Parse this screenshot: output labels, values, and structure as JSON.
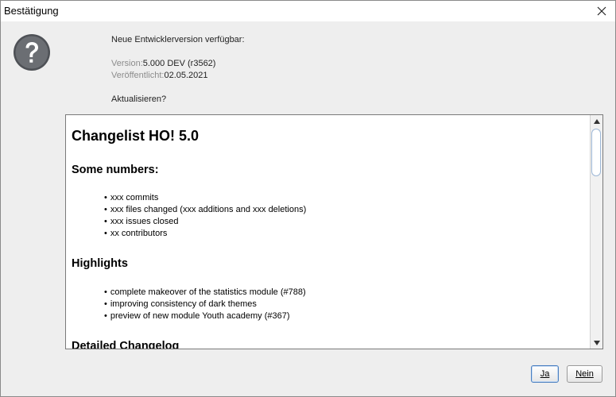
{
  "window": {
    "title": "Bestätigung"
  },
  "message": {
    "intro": "Neue Entwicklerversion verfügbar:",
    "version_label": "Version:",
    "version_value": "5.000 DEV (r3562)",
    "published_label": "Veröffentlicht:",
    "published_value": "02.05.2021",
    "question": "Aktualisieren?"
  },
  "changelog": {
    "title": "Changelist HO! 5.0",
    "sections": [
      {
        "heading": "Some numbers:",
        "items": [
          "xxx commits",
          "xxx files changed (xxx additions and xxx deletions)",
          "xxx issues closed",
          "xx contributors"
        ]
      },
      {
        "heading": "Highlights",
        "items": [
          "complete makeover of the statistics module (#788)",
          "improving consistency of dark themes",
          "preview of new module Youth academy (#367)"
        ]
      },
      {
        "heading": "Detailed Changelog",
        "items": []
      }
    ]
  },
  "buttons": {
    "yes": "Ja",
    "no": "Nein"
  },
  "icons": {
    "close": "close-icon",
    "question": "question-icon",
    "scroll_up": "chevron-up-icon",
    "scroll_down": "chevron-down-icon"
  },
  "colors": {
    "dialog_bg": "#eeeeee",
    "label_gray": "#8c8c8c",
    "icon_gray": "#5f6266",
    "focus_border": "#4a7fc0"
  }
}
